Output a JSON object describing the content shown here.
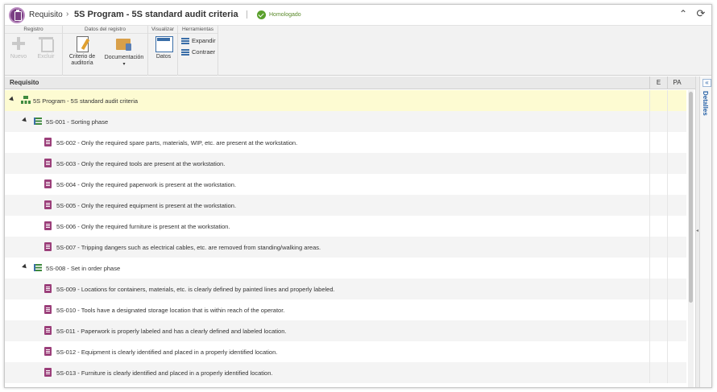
{
  "header": {
    "module": "Requisito",
    "title": "5S Program - 5S standard audit criteria",
    "status": "Homologado"
  },
  "toolbar": {
    "groups": {
      "registro": "Registro",
      "datos_registro": "Datos del registro",
      "visualizar": "Visualizar",
      "herramientas": "Herramientas"
    },
    "buttons": {
      "nuevo": "Nuevo",
      "excluir": "Excluir",
      "criterio_line1": "Criterio de",
      "criterio_line2": "auditoría",
      "documentacion": "Documentación",
      "datos": "Datos",
      "expandir": "Expandir",
      "contraer": "Contraer"
    }
  },
  "grid": {
    "columns": {
      "requisito": "Requisito",
      "e": "E",
      "pa": "PA"
    },
    "rows": [
      {
        "level": 0,
        "kind": "root",
        "text": "5S Program - 5S standard audit criteria",
        "selected": true
      },
      {
        "level": 1,
        "kind": "group",
        "text": "5S-001 - Sorting phase"
      },
      {
        "level": 2,
        "kind": "item",
        "text": "5S-002 - Only the required spare parts, materials, WIP, etc. are present at the workstation."
      },
      {
        "level": 2,
        "kind": "item",
        "text": "5S-003 - Only the required tools are present at the workstation."
      },
      {
        "level": 2,
        "kind": "item",
        "text": "5S-004 - Only the required paperwork is present at the workstation."
      },
      {
        "level": 2,
        "kind": "item",
        "text": "5S-005 - Only the required equipment is present at the workstation."
      },
      {
        "level": 2,
        "kind": "item",
        "text": "5S-006 - Only the required furniture is present at the workstation."
      },
      {
        "level": 2,
        "kind": "item",
        "text": "5S-007 - Tripping dangers such as electrical cables, etc. are removed from standing/walking areas."
      },
      {
        "level": 1,
        "kind": "group",
        "text": "5S-008 - Set in order phase"
      },
      {
        "level": 2,
        "kind": "item",
        "text": "5S-009 - Locations for containers, materials, etc. is clearly defined by painted lines and properly labeled."
      },
      {
        "level": 2,
        "kind": "item",
        "text": "5S-010 - Tools have a designated storage location that is within reach of the operator."
      },
      {
        "level": 2,
        "kind": "item",
        "text": "5S-011 - Paperwork is properly labeled and has a clearly defined and labeled location."
      },
      {
        "level": 2,
        "kind": "item",
        "text": "5S-012 - Equipment is clearly identified and placed in a properly identified location."
      },
      {
        "level": 2,
        "kind": "item",
        "text": "5S-013 - Furniture is clearly identified and placed in a properly identified location."
      }
    ]
  },
  "details": {
    "label": "Detalles"
  },
  "colors": {
    "accent": "#2a64a8",
    "selected_row": "#fdfbd2",
    "brand": "#7a3e83",
    "status": "#5aa02c"
  }
}
